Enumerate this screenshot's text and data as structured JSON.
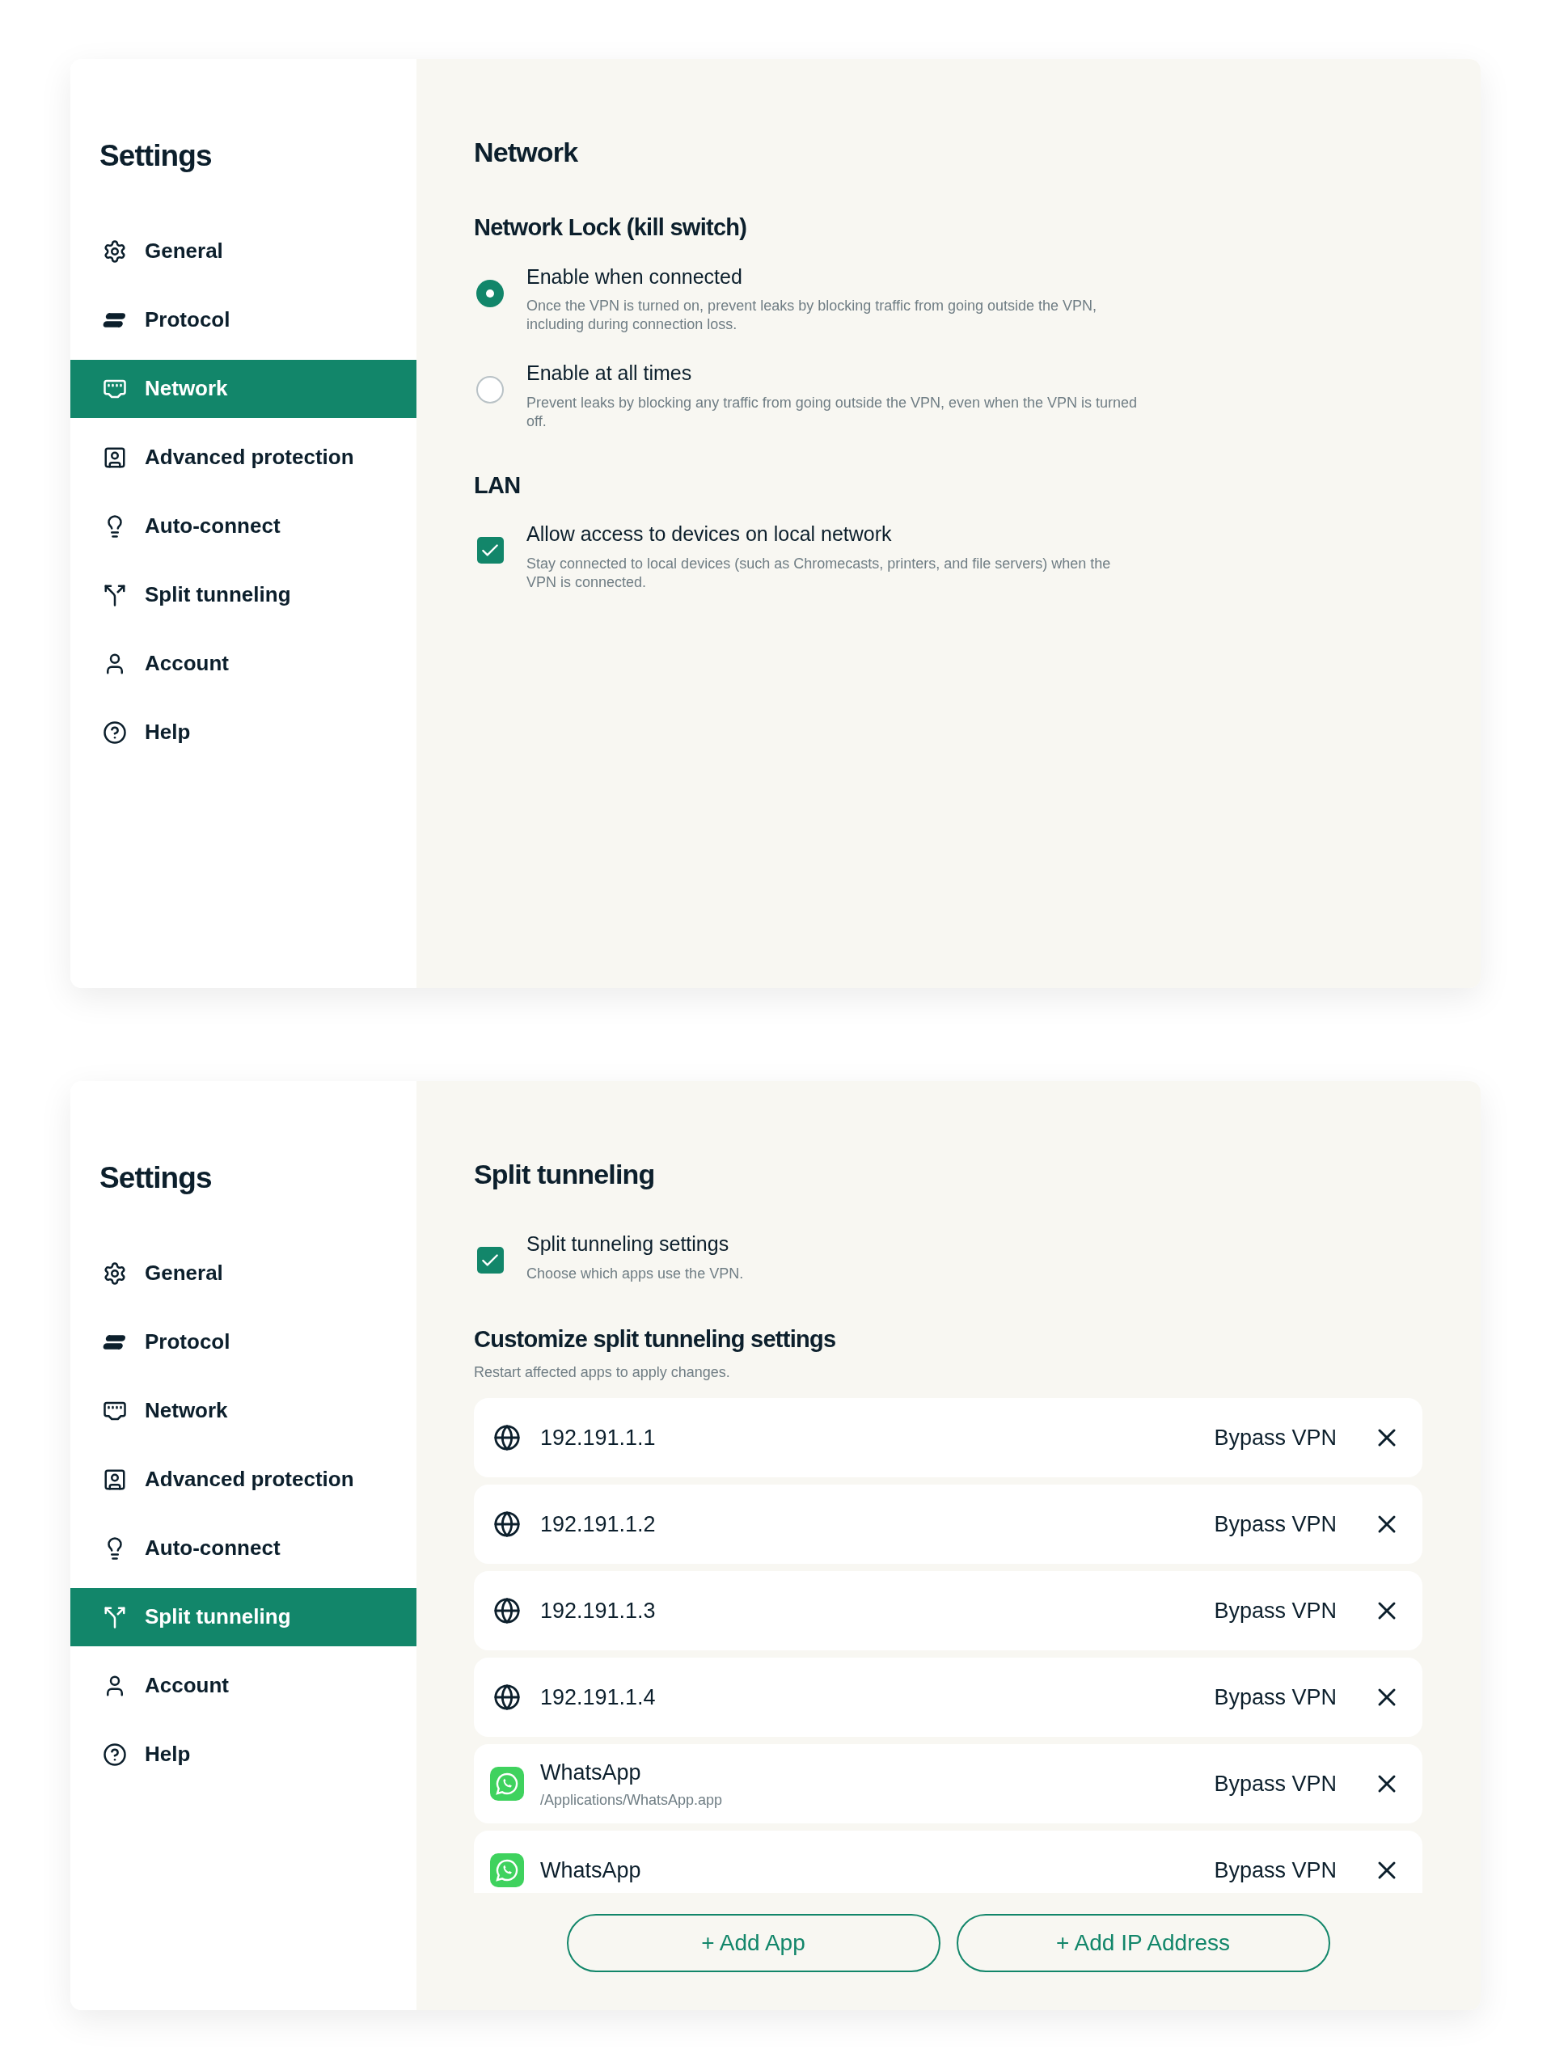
{
  "panels": [
    {
      "sidebar": {
        "title": "Settings",
        "items": [
          {
            "label": "General",
            "selected": false
          },
          {
            "label": "Protocol",
            "selected": false
          },
          {
            "label": "Network",
            "selected": true
          },
          {
            "label": "Advanced protection",
            "selected": false
          },
          {
            "label": "Auto-connect",
            "selected": false
          },
          {
            "label": "Split tunneling",
            "selected": false
          },
          {
            "label": "Account",
            "selected": false
          },
          {
            "label": "Help",
            "selected": false
          }
        ]
      },
      "content": {
        "kind": "network",
        "title": "Network",
        "sections": [
          {
            "title": "Network Lock (kill switch)",
            "options": [
              {
                "kind": "radio",
                "label": "Enable when connected",
                "description": "Once the VPN is turned on, prevent leaks by blocking traffic from going outside the VPN, including during connection loss.",
                "selected": true
              },
              {
                "kind": "radio",
                "label": "Enable at all times",
                "description": "Prevent leaks by blocking any traffic from going outside the VPN, even when the VPN is turned off.",
                "selected": false
              }
            ]
          },
          {
            "title": "LAN",
            "options": [
              {
                "kind": "checkbox",
                "label": "Allow access to devices on local network",
                "description": "Stay connected to local devices (such as Chromecasts, printers, and file servers) when the VPN is connected.",
                "checked": true
              }
            ]
          }
        ]
      }
    },
    {
      "sidebar": {
        "title": "Settings",
        "items": [
          {
            "label": "General",
            "selected": false
          },
          {
            "label": "Protocol",
            "selected": false
          },
          {
            "label": "Network",
            "selected": false
          },
          {
            "label": "Advanced protection",
            "selected": false
          },
          {
            "label": "Auto-connect",
            "selected": false
          },
          {
            "label": "Split tunneling",
            "selected": true
          },
          {
            "label": "Account",
            "selected": false
          },
          {
            "label": "Help",
            "selected": false
          }
        ]
      },
      "content": {
        "kind": "split",
        "title": "Split tunneling",
        "toggle": {
          "kind": "checkbox",
          "label": "Split tunneling settings",
          "description": "Choose which apps use the VPN.",
          "checked": true
        },
        "customize": {
          "title": "Customize split tunneling settings",
          "subtitle": "Restart affected apps to apply changes."
        },
        "entries": [
          {
            "kind": "ip",
            "name": "192.191.1.1",
            "action": "Bypass VPN"
          },
          {
            "kind": "ip",
            "name": "192.191.1.2",
            "action": "Bypass VPN"
          },
          {
            "kind": "ip",
            "name": "192.191.1.3",
            "action": "Bypass VPN"
          },
          {
            "kind": "ip",
            "name": "192.191.1.4",
            "action": "Bypass VPN"
          },
          {
            "kind": "app",
            "name": "WhatsApp",
            "path": "/Applications/WhatsApp.app",
            "action": "Bypass VPN"
          },
          {
            "kind": "app",
            "name": "WhatsApp",
            "action": "Bypass VPN"
          }
        ],
        "buttons": [
          "+ Add App",
          "+ Add IP Address"
        ]
      }
    }
  ]
}
